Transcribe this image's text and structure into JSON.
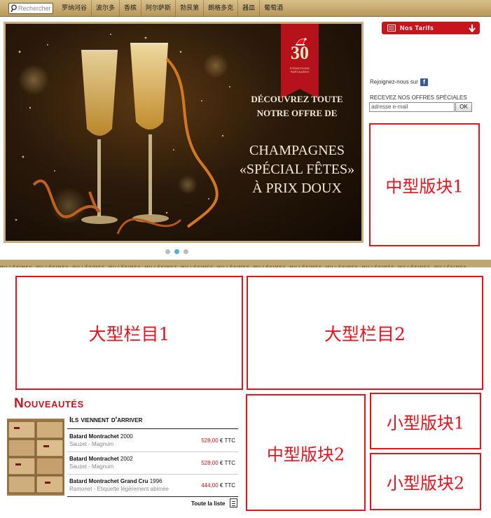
{
  "topbar": {
    "search_placeholder": "Rechercher",
    "nav": [
      "罗纳河谷",
      "波尔多",
      "香槟",
      "阿尔萨斯",
      "勃艮第",
      "朗格多克",
      "器皿",
      "葡萄酒"
    ]
  },
  "banner": {
    "ribbon_number": "30",
    "ribbon_text": "D'ÉMOTIONS PARTAGÉES",
    "line1": "DÉCOUVREZ TOUTE",
    "line2": "NOTRE OFFRE DE",
    "line3": "CHAMPAGNES",
    "line4": "«SPÉCIAL FÊTES»",
    "line5": "À PRIX DOUX"
  },
  "carousel": {
    "slides": 3,
    "active_index": 1
  },
  "sidebar": {
    "tarifs_label": "Nos Tarifs",
    "rejoignez": "Rejoignez-nous sur",
    "facebook": "f",
    "offers_label": "RECEVEZ NOS OFFRES SPÉCIALES",
    "email_placeholder": "adresse e-mail",
    "ok_label": "OK"
  },
  "strip": {
    "word": "MILLÉSIMES",
    "repeat": 13
  },
  "placeholders": {
    "medium1": "中型版块1",
    "large1": "大型栏目1",
    "large2": "大型栏目2",
    "medium2": "中型版块2",
    "small1": "小型版块1",
    "small2": "小型版块2"
  },
  "nouveautes": {
    "title": "Nouveautés",
    "subtitle": "Ils viennent d'arriver",
    "items": [
      {
        "name": "Batard Montrachet",
        "year": "2000",
        "producer": "Sauzet",
        "format": "Magnum",
        "price": "528,00",
        "currency": "€ TTC"
      },
      {
        "name": "Batard Montrachet",
        "year": "2002",
        "producer": "Sauzet",
        "format": "Magnum",
        "price": "528,00",
        "currency": "€ TTC"
      },
      {
        "name": "Batard Montrachet Grand Cru",
        "year": "1996",
        "producer": "Ramonet",
        "format": "Etiquette légèrement abimée",
        "price": "444,00",
        "currency": "€ TTC"
      }
    ],
    "see_all": "Toute la liste"
  },
  "colors": {
    "brand_red": "#c8141d",
    "placeholder_red": "#e3141e",
    "gold": "#c7b184",
    "active_dot": "#4ab0d8"
  }
}
